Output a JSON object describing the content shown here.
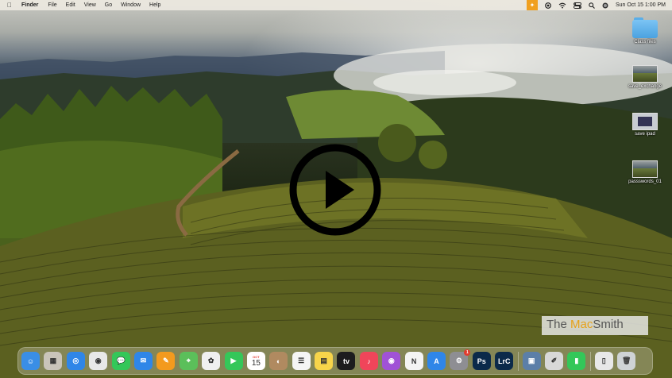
{
  "menubar": {
    "apple_icon": "apple-logo-icon",
    "app_name": "Finder",
    "menus": [
      "File",
      "Edit",
      "View",
      "Go",
      "Window",
      "Help"
    ],
    "status_icons": [
      "app-status-icon",
      "circle-status-icon",
      "wifi-icon",
      "control-center-icon",
      "search-icon",
      "siri-icon"
    ],
    "clock": "Sun Oct 15  1:00 PM",
    "accent_color": "#f0a020"
  },
  "desktop": {
    "icons": [
      {
        "label": "Class files",
        "type": "folder"
      },
      {
        "label": "save_exchange",
        "type": "screenshot"
      },
      {
        "label": "save ipad",
        "type": "screenshot"
      },
      {
        "label": "passswords_01",
        "type": "screenshot"
      }
    ]
  },
  "video": {
    "play_icon": "play-icon"
  },
  "watermark": {
    "text_a": "The ",
    "text_b": "Mac",
    "text_c": "Smith",
    "accent_color": "#e6a11a"
  },
  "dock": {
    "items": [
      {
        "name": "finder",
        "glyph": "☺",
        "color": "#3a8ee6"
      },
      {
        "name": "launchpad",
        "glyph": "▦",
        "color": "#c9c4ba"
      },
      {
        "name": "safari",
        "glyph": "◎",
        "color": "#2f86e8"
      },
      {
        "name": "chrome",
        "glyph": "◉",
        "color": "#e8e8e8"
      },
      {
        "name": "messages",
        "glyph": "💬",
        "color": "#34c759"
      },
      {
        "name": "mail",
        "glyph": "✉",
        "color": "#2f86e8"
      },
      {
        "name": "pages",
        "glyph": "✎",
        "color": "#f39a1e"
      },
      {
        "name": "maps",
        "glyph": "⌖",
        "color": "#5bbf5a"
      },
      {
        "name": "photos",
        "glyph": "✿",
        "color": "#f0f0f0"
      },
      {
        "name": "facetime",
        "glyph": "▶",
        "color": "#34c759"
      },
      {
        "name": "calendar",
        "month": "OCT",
        "day": "15",
        "color": "#ffffff"
      },
      {
        "name": "contacts",
        "glyph": "◐",
        "color": "#b08a60"
      },
      {
        "name": "reminders",
        "glyph": "☰",
        "color": "#f5f5f5"
      },
      {
        "name": "notes",
        "glyph": "▤",
        "color": "#f7d44a"
      },
      {
        "name": "apple-tv",
        "glyph": "tv",
        "color": "#1c1c1e"
      },
      {
        "name": "music",
        "glyph": "♪",
        "color": "#f0455a"
      },
      {
        "name": "podcasts",
        "glyph": "◉",
        "color": "#a052d6"
      },
      {
        "name": "news",
        "glyph": "N",
        "color": "#f4f4f4"
      },
      {
        "name": "app-store",
        "glyph": "A",
        "color": "#2f86e8"
      },
      {
        "name": "system-settings",
        "glyph": "⚙",
        "color": "#8e8e93",
        "badge": "1"
      },
      {
        "name": "photoshop",
        "glyph": "Ps",
        "color": "#0b2a4a"
      },
      {
        "name": "lightroom-classic",
        "glyph": "LrC",
        "color": "#0b2a4a"
      },
      {
        "name": "preview",
        "glyph": "▣",
        "color": "#5c7fa8"
      },
      {
        "name": "script-editor",
        "glyph": "✐",
        "color": "#d8d8d8"
      },
      {
        "name": "numbers",
        "glyph": "▮",
        "color": "#34c759"
      },
      {
        "name": "document-stack",
        "glyph": "▯",
        "color": "#e8e8e8"
      },
      {
        "name": "trash",
        "glyph": "🗑",
        "color": "#cfd3d6"
      }
    ]
  }
}
